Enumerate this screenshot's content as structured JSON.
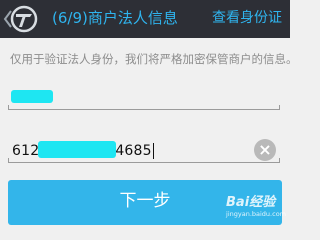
{
  "header": {
    "title": "(6/9)商户法人信息",
    "action_label": "查看身份证",
    "back_icon": "chevron-left-icon",
    "logo_icon": "app-logo-icon",
    "background": "#2d2f36",
    "accent": "#2fb4ee"
  },
  "info_text": "仅用于验证法人身份，我们将严格加密保管商户的信息。",
  "form": {
    "name_field": {
      "value": ""
    },
    "id_field": {
      "value_prefix": "612",
      "value_suffix": "4685"
    },
    "clear_icon": "clear-icon"
  },
  "next_button": {
    "label": "下一步",
    "color": "#33b5ea"
  },
  "watermark": {
    "brand": "Bai经验",
    "url": "jingyan.baidu.com"
  },
  "mask_color": "#1ee6f2"
}
